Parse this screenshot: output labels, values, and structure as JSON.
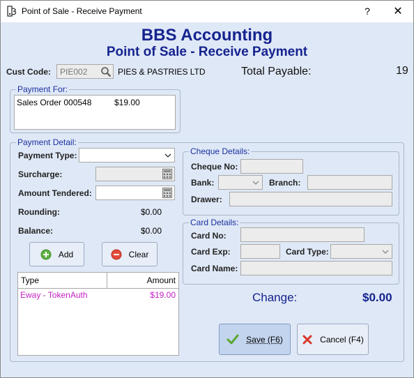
{
  "window": {
    "title": "Point of Sale - Receive Payment",
    "help_glyph": "?",
    "close_glyph": "✕"
  },
  "header": {
    "company": "BBS Accounting",
    "screen": "Point of Sale - Receive Payment"
  },
  "customer": {
    "code_label": "Cust Code:",
    "code_value": "PIE002",
    "name": "PIES & PASTRIES LTD",
    "total_payable_label": "Total Payable:",
    "total_payable_value": "19"
  },
  "payment_for": {
    "title": "Payment For:",
    "items": [
      {
        "description": "Sales Order 000548",
        "amount": "$19.00"
      }
    ]
  },
  "payment_detail": {
    "title": "Payment Detail:",
    "payment_type_label": "Payment Type:",
    "payment_type_value": "",
    "surcharge_label": "Surcharge:",
    "amount_tendered_label": "Amount Tendered:",
    "rounding_label": "Rounding:",
    "rounding_value": "$0.00",
    "balance_label": "Balance:",
    "balance_value": "$0.00",
    "add_label": "Add",
    "clear_label": "Clear",
    "grid": {
      "columns": [
        "Type",
        "Amount"
      ],
      "rows": [
        {
          "type": "Eway - TokenAuth",
          "amount": "$19.00"
        }
      ]
    }
  },
  "cheque": {
    "title": "Cheque Details:",
    "cheque_no_label": "Cheque No:",
    "bank_label": "Bank:",
    "branch_label": "Branch:",
    "drawer_label": "Drawer:"
  },
  "card": {
    "title": "Card Details:",
    "card_no_label": "Card No:",
    "card_exp_label": "Card Exp:",
    "card_type_label": "Card Type:",
    "card_name_label": "Card Name:"
  },
  "change": {
    "label": "Change:",
    "value": "$0.00"
  },
  "actions": {
    "save_label": "Save (F6)",
    "cancel_label": "Cancel (F4)"
  },
  "colors": {
    "heading": "#15238f",
    "group_title": "#1a2fa0",
    "grid_row": "#c51fc5",
    "background": "#dfe8f6"
  }
}
